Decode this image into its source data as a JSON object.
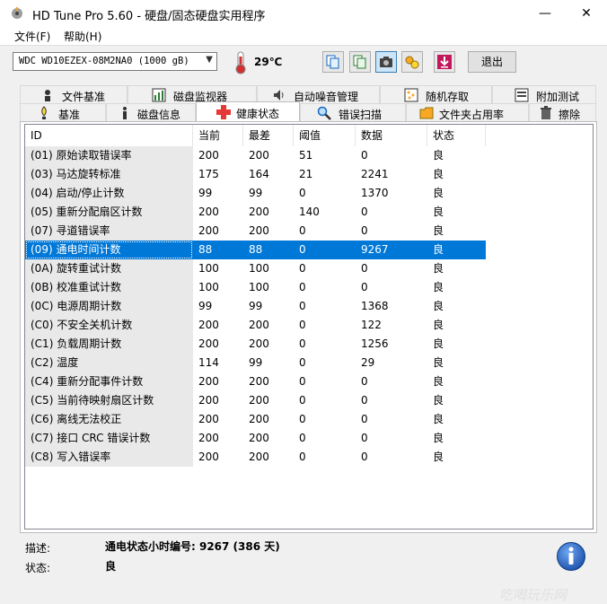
{
  "window": {
    "title": "HD Tune Pro 5.60 - 硬盘/固态硬盘实用程序"
  },
  "menu": {
    "items": [
      "文件(F)",
      "帮助(H)"
    ]
  },
  "toolbar": {
    "drive": "WDC WD10EZEX-08M2NA0 (1000 gB)",
    "temperature": "29℃",
    "exit_label": "退出"
  },
  "tabs_top": [
    "文件基准",
    "磁盘监视器",
    "自动噪音管理",
    "随机存取",
    "附加测试"
  ],
  "tabs_bottom": [
    "基准",
    "磁盘信息",
    "健康状态",
    "错误扫描",
    "文件夹占用率",
    "擦除"
  ],
  "selected_tab": "健康状态",
  "table": {
    "columns": [
      "ID",
      "当前",
      "最差",
      "阈值",
      "数据",
      "状态"
    ],
    "rows": [
      [
        "(01) 原始读取错误率",
        "200",
        "200",
        "51",
        "0",
        "良"
      ],
      [
        "(03) 马达旋转标准",
        "175",
        "164",
        "21",
        "2241",
        "良"
      ],
      [
        "(04) 启动/停止计数",
        "99",
        "99",
        "0",
        "1370",
        "良"
      ],
      [
        "(05) 重新分配扇区计数",
        "200",
        "200",
        "140",
        "0",
        "良"
      ],
      [
        "(07) 寻道错误率",
        "200",
        "200",
        "0",
        "0",
        "良"
      ],
      [
        "(09) 通电时间计数",
        "88",
        "88",
        "0",
        "9267",
        "良"
      ],
      [
        "(0A) 旋转重试计数",
        "100",
        "100",
        "0",
        "0",
        "良"
      ],
      [
        "(0B) 校准重试计数",
        "100",
        "100",
        "0",
        "0",
        "良"
      ],
      [
        "(0C) 电源周期计数",
        "99",
        "99",
        "0",
        "1368",
        "良"
      ],
      [
        "(C0) 不安全关机计数",
        "200",
        "200",
        "0",
        "122",
        "良"
      ],
      [
        "(C1) 负载周期计数",
        "200",
        "200",
        "0",
        "1256",
        "良"
      ],
      [
        "(C2) 温度",
        "114",
        "99",
        "0",
        "29",
        "良"
      ],
      [
        "(C4) 重新分配事件计数",
        "200",
        "200",
        "0",
        "0",
        "良"
      ],
      [
        "(C5) 当前待映射扇区计数",
        "200",
        "200",
        "0",
        "0",
        "良"
      ],
      [
        "(C6) 离线无法校正",
        "200",
        "200",
        "0",
        "0",
        "良"
      ],
      [
        "(C7) 接口 CRC 错误计数",
        "200",
        "200",
        "0",
        "0",
        "良"
      ],
      [
        "(C8) 写入错误率",
        "200",
        "200",
        "0",
        "0",
        "良"
      ]
    ],
    "selected_row": 5
  },
  "details": {
    "desc_label": "描述:",
    "desc_value": "通电状态小时编号: 9267 (386 天)",
    "status_label": "状态:",
    "status_value": "良"
  },
  "watermark": "吃喝玩乐网",
  "colors": {
    "selection": "#0078d7",
    "id_column_bg": "#e9e9e9",
    "exit_icon": "#c2185b"
  }
}
